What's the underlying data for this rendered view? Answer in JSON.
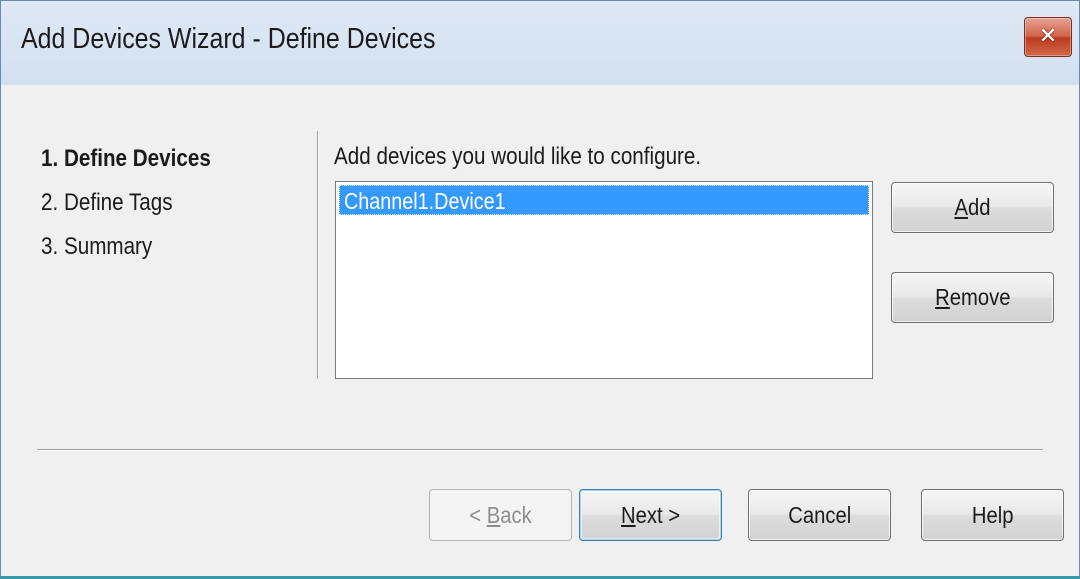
{
  "window": {
    "title": "Add Devices Wizard - Define Devices",
    "close_glyph": "✕"
  },
  "steps": [
    {
      "label": "1. Define Devices",
      "active": true
    },
    {
      "label": "2. Define Tags",
      "active": false
    },
    {
      "label": "3. Summary",
      "active": false
    }
  ],
  "instruction": "Add devices you would like to configure.",
  "devices": [
    {
      "name": "Channel1.Device1",
      "selected": true
    }
  ],
  "side_buttons": {
    "add": {
      "mnemonic": "A",
      "rest": "dd"
    },
    "remove": {
      "mnemonic": "R",
      "rest": "emove"
    }
  },
  "footer_buttons": {
    "back": {
      "prefix": "< ",
      "mnemonic": "B",
      "rest": "ack",
      "enabled": false
    },
    "next": {
      "mnemonic": "N",
      "rest": "ext >",
      "default": true
    },
    "cancel": {
      "label": "Cancel"
    },
    "help": {
      "label": "Help"
    }
  },
  "colors": {
    "selection": "#3399ff",
    "close_button": "#c7452a",
    "accent_border": "#3a9aa8"
  }
}
